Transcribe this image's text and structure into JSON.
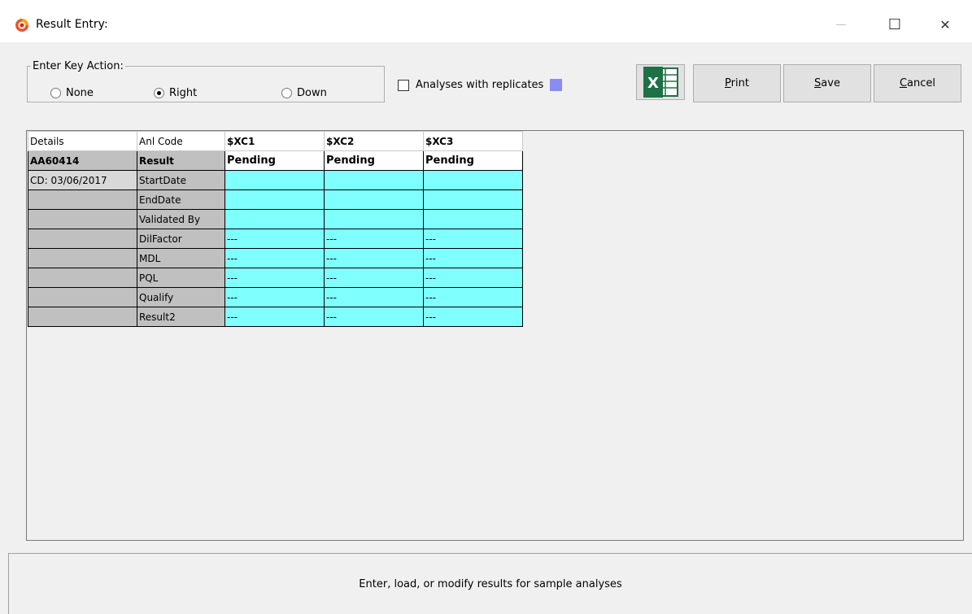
{
  "window": {
    "title": "Result Entry:",
    "icon": "app-logo-icon",
    "controls": {
      "minimize": "—",
      "maximize": "☐",
      "close": "✕"
    }
  },
  "key_action": {
    "legend": "Enter Key Action:",
    "options": [
      {
        "label": "None",
        "selected": false
      },
      {
        "label": "Right",
        "selected": true
      },
      {
        "label": "Down",
        "selected": false
      }
    ]
  },
  "replicates": {
    "label": "Analyses with replicates",
    "checked": false,
    "swatch_color": "#8b8bf5"
  },
  "toolbar": {
    "excel_icon": "excel-icon",
    "excel_letter": "X",
    "print": {
      "label": "Print",
      "mnemonic": "P"
    },
    "save": {
      "label": "Save",
      "mnemonic": "S"
    },
    "cancel": {
      "label": "Cancel",
      "mnemonic": "C"
    }
  },
  "grid": {
    "header": {
      "details": "Details",
      "anl_code": "Anl Code",
      "cols": [
        "$XC1",
        "$XC2",
        "$XC3"
      ]
    },
    "rows": [
      {
        "detail": "AA60414",
        "label": "Result",
        "values": [
          "Pending",
          "Pending",
          "Pending"
        ]
      },
      {
        "detail": "CD: 03/06/2017",
        "label": "StartDate",
        "values": [
          "",
          "",
          ""
        ]
      },
      {
        "detail": "",
        "label": "EndDate",
        "values": [
          "",
          "",
          ""
        ]
      },
      {
        "detail": "",
        "label": "Validated By",
        "values": [
          "",
          "",
          ""
        ]
      },
      {
        "detail": "",
        "label": "DilFactor",
        "values": [
          "---",
          "---",
          "---"
        ]
      },
      {
        "detail": "",
        "label": "MDL",
        "values": [
          "---",
          "---",
          "---"
        ]
      },
      {
        "detail": "",
        "label": "PQL",
        "values": [
          "---",
          "---",
          "---"
        ]
      },
      {
        "detail": "",
        "label": "Qualify",
        "values": [
          "---",
          "---",
          "---"
        ]
      },
      {
        "detail": "",
        "label": "Result2",
        "values": [
          "---",
          "---",
          "---"
        ]
      }
    ],
    "colors": {
      "editable": "#80ffff",
      "label": "#c0c0c0"
    }
  },
  "status": {
    "text": "Enter, load, or modify results for sample analyses"
  }
}
